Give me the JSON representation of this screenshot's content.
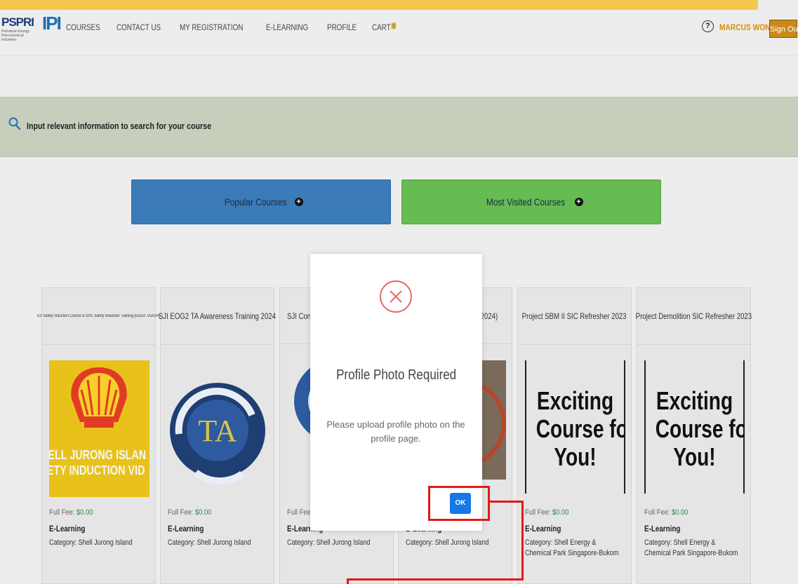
{
  "header": {
    "logo_primary": "PSPRI",
    "logo_primary_sub": "Petroleum Energy Petrochemical Industries",
    "logo_secondary": "IPI",
    "nav": [
      "COURSES",
      "CONTACT US",
      "MY REGISTRATION",
      "E-LEARNING",
      "PROFILE",
      "CART"
    ],
    "cart_count": "0",
    "help_symbol": "?",
    "username": "MARCUS WONG",
    "signout_label": "Sign Out"
  },
  "search": {
    "prompt": "Input relevant information to search for your course"
  },
  "sections": {
    "popular_label": "Popular Courses",
    "visited_label": "Most Visited Courses"
  },
  "cards": [
    {
      "title": "SJI Safety Induction Course & SPC Safety Induction Training (EOG2 TA2024)",
      "image_text": "HELL JURONG ISLAN\nFETY INDUCTION VID",
      "fee_label": "Full Fee:",
      "fee": "$0.00",
      "type": "E-Learning",
      "category": "Category: Shell Jurong Island"
    },
    {
      "title": "SJI EOG2 TA Awareness Training 2024",
      "image_text": "TA",
      "fee_label": "Full Fee:",
      "fee": "$0.00",
      "type": "E-Learning",
      "category": "Category: Shell Jurong Island"
    },
    {
      "title": "SJI Confi",
      "fee_label": "Full Fee:",
      "fee": "",
      "type": "E-Learning",
      "category": "Category: Shell Jurong Island"
    },
    {
      "title": "TA2024)",
      "fee_label": "",
      "fee": "",
      "type": "E-Learning",
      "category": "Category: Shell Jurong Island"
    },
    {
      "title": "Project SBM II SIC Refresher 2023",
      "image_text": "Exciting\nCourse for\nYou!",
      "fee_label": "Full Fee:",
      "fee": "$0.00",
      "type": "E-Learning",
      "category": "Category: Shell Energy & Chemical Park Singapore-Bukom"
    },
    {
      "title": "Project Demolition SIC Refresher 2023",
      "image_text": "Exciting\nCourse for\nYou!",
      "fee_label": "Full Fee:",
      "fee": "$0.00",
      "type": "E-Learning",
      "category": "Category: Shell Energy & Chemical Park Singapore-Bukom"
    }
  ],
  "modal": {
    "title": "Profile Photo Required",
    "message": "Please upload profile photo on the profile page.",
    "ok_label": "OK"
  },
  "colors": {
    "accent_yellow": "#f2c94c",
    "popular_blue": "#3a7bb8",
    "visited_green": "#66bb52",
    "ok_blue": "#1677e6",
    "error_red": "#e46b6b",
    "annotation_red": "#e21818"
  }
}
